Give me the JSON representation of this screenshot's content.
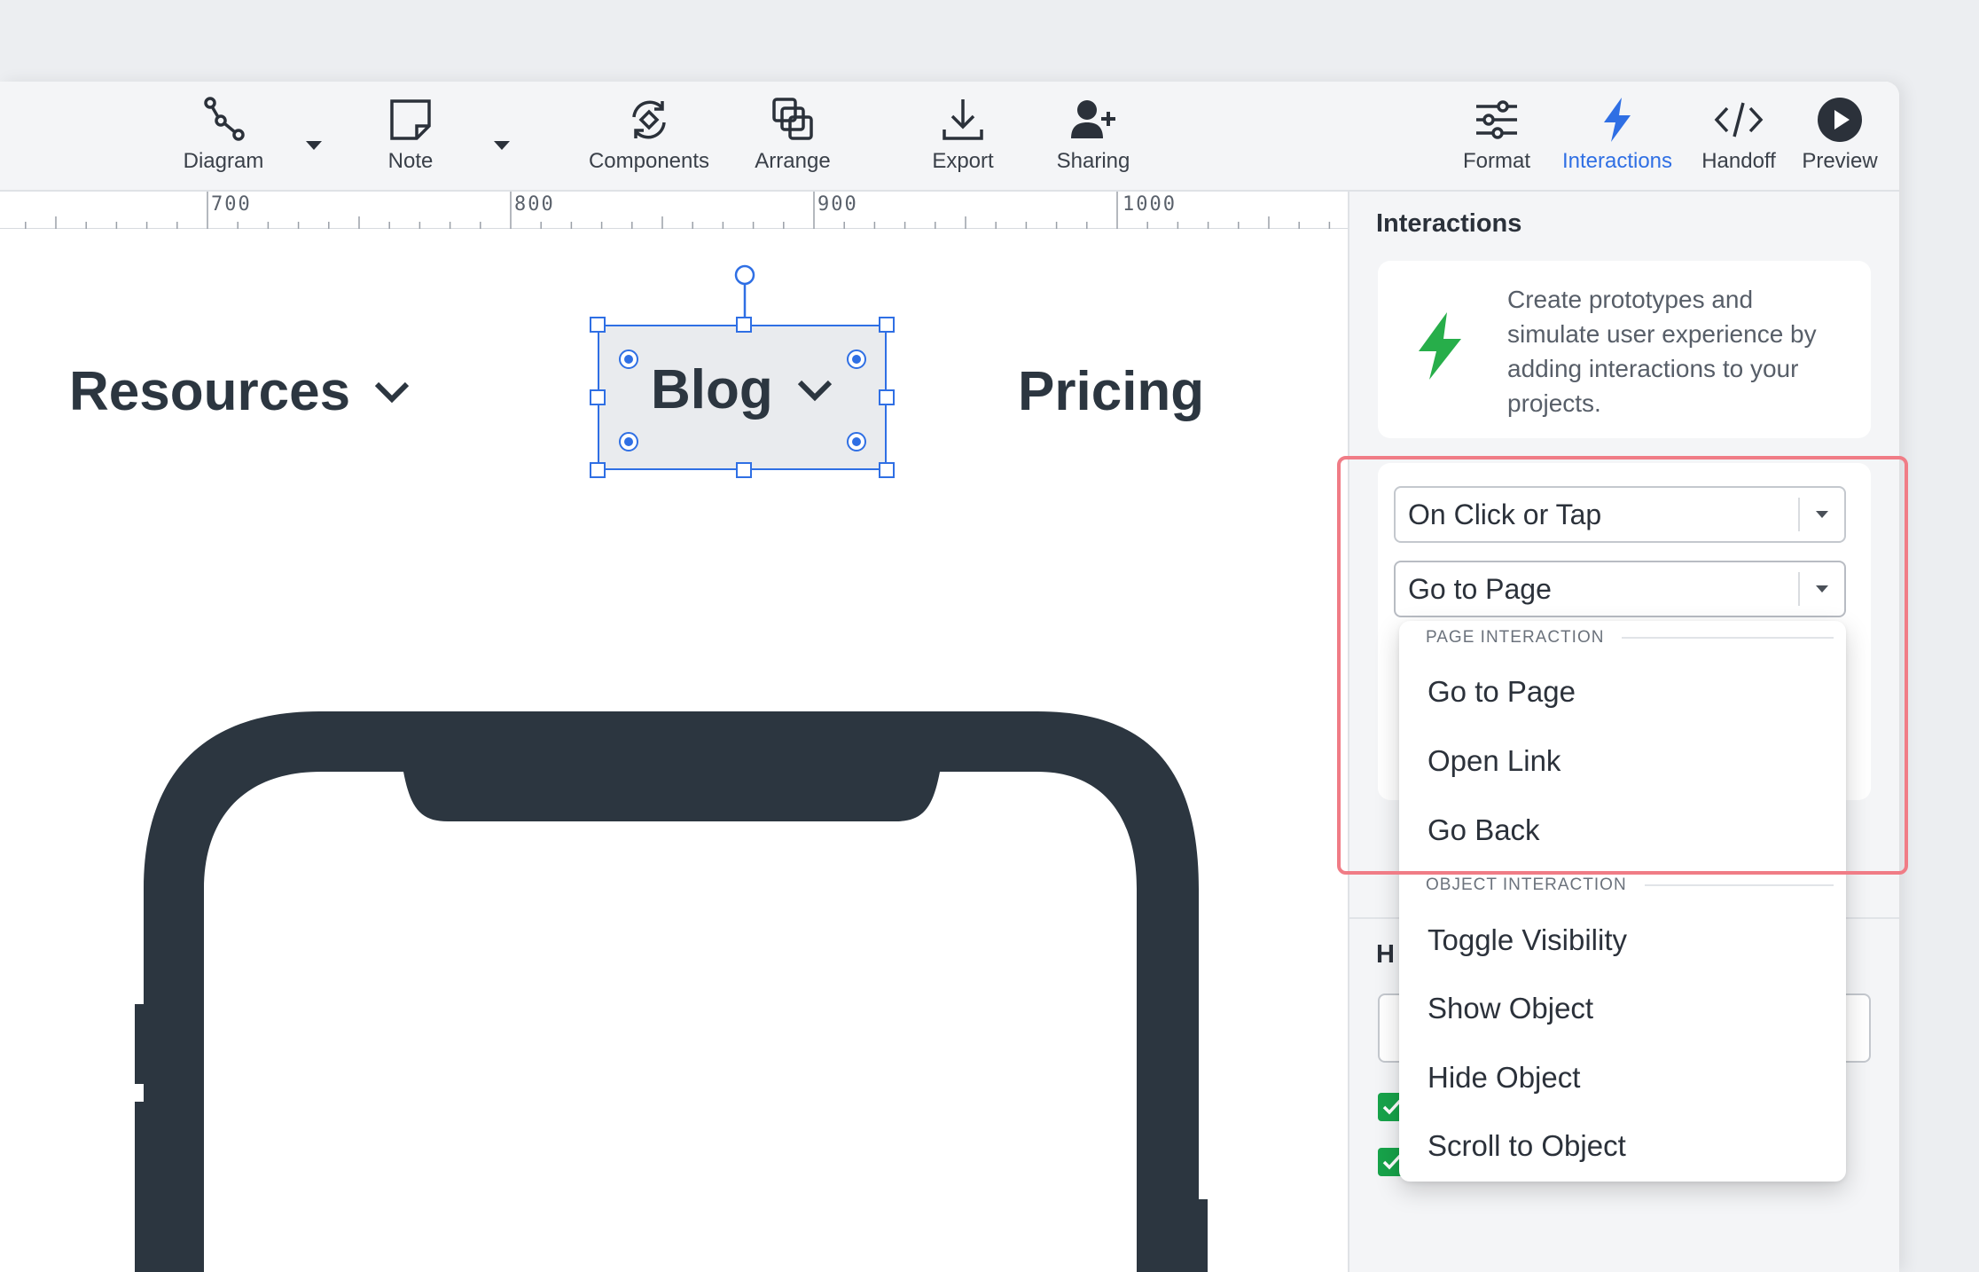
{
  "toolbar": {
    "left_tools": [
      {
        "label": "Diagram",
        "icon": "diagram-icon"
      },
      {
        "label": "Note",
        "icon": "note-icon"
      },
      {
        "label": "Components",
        "icon": "components-icon"
      },
      {
        "label": "Arrange",
        "icon": "arrange-icon"
      },
      {
        "label": "Export",
        "icon": "export-icon"
      },
      {
        "label": "Sharing",
        "icon": "sharing-icon"
      }
    ],
    "right_tools": [
      {
        "label": "Format",
        "icon": "format-icon"
      },
      {
        "label": "Interactions",
        "icon": "lightning-icon",
        "active": true
      },
      {
        "label": "Handoff",
        "icon": "code-icon"
      },
      {
        "label": "Preview",
        "icon": "play-icon"
      }
    ]
  },
  "ruler": {
    "labels": [
      "700",
      "800",
      "900",
      "1000"
    ]
  },
  "canvas": {
    "nav_items": [
      "Resources",
      "Blog",
      "Pricing"
    ],
    "selected_item": "Blog"
  },
  "panel": {
    "title": "Interactions",
    "info_text": "Create prototypes and simulate user experience by adding interactions to your projects.",
    "trigger_select": "On Click or Tap",
    "action_select": "Go to Page",
    "lower_heading_partial": "H"
  },
  "dropdown": {
    "page_group": "PAGE INTERACTION",
    "page_items": [
      "Go to Page",
      "Open Link",
      "Go Back"
    ],
    "object_group": "OBJECT INTERACTION",
    "object_items": [
      "Toggle Visibility",
      "Show Object",
      "Hide Object",
      "Scroll to Object"
    ]
  },
  "colors": {
    "accent": "#2f6fe4",
    "lightning": "#27ae4a",
    "highlight": "#f07c86",
    "text_dark": "#2c3640"
  }
}
